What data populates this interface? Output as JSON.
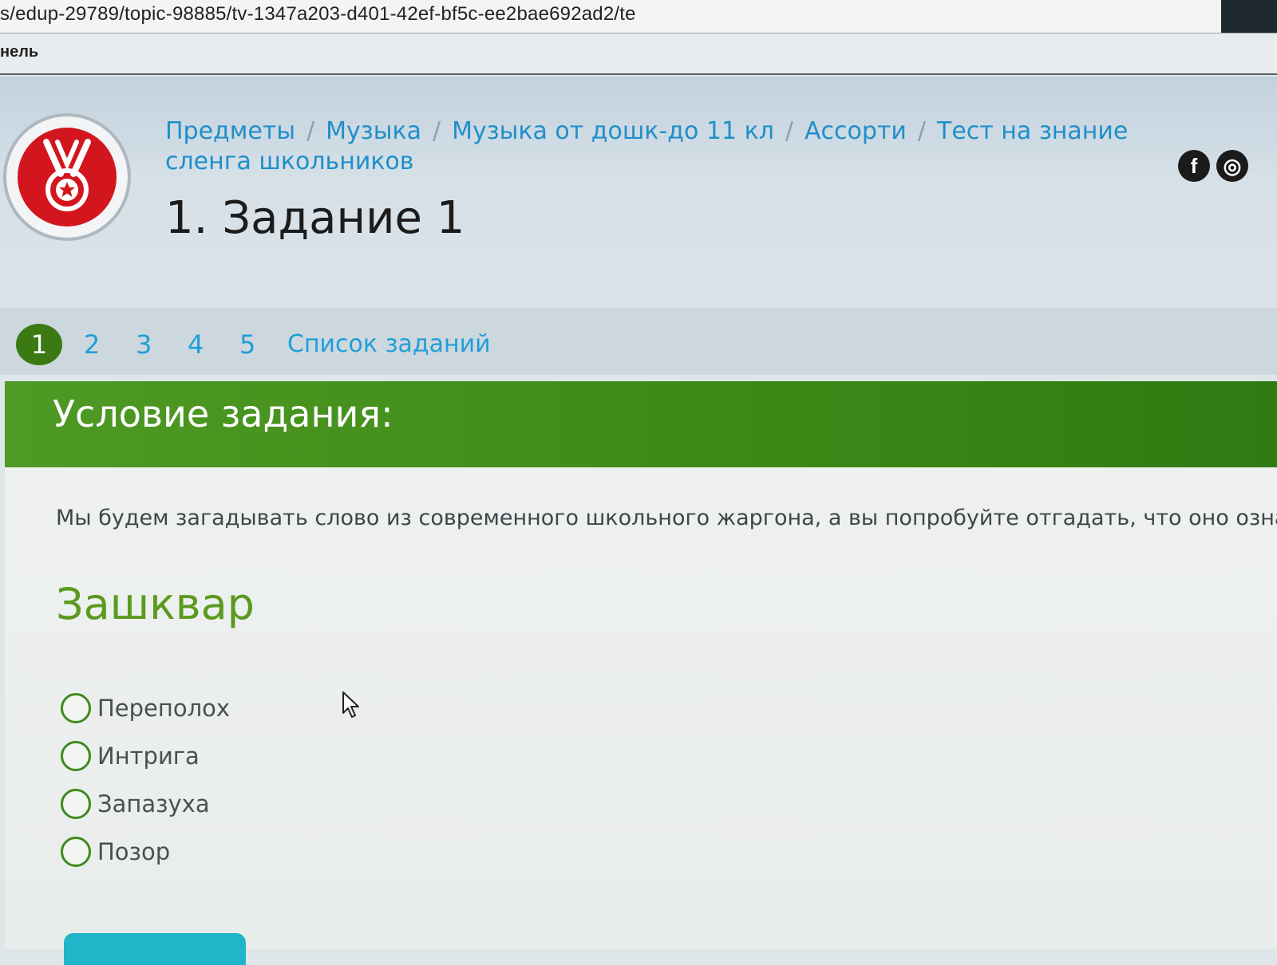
{
  "browser": {
    "address": "s/edup-29789/topic-98885/tv-1347a203-d401-42ef-bf5c-ee2bae692ad2/te",
    "bookmark": "нель"
  },
  "header": {
    "breadcrumb": [
      "Предметы",
      "Музыка",
      "Музыка от дошк-до 11 кл",
      "Ассорти",
      "Тест на знание сленга школьников"
    ],
    "separator": "/",
    "title": "1. Задание 1",
    "social": {
      "facebook": "f",
      "other": "◎"
    }
  },
  "task_nav": {
    "numbers": [
      "1",
      "2",
      "3",
      "4",
      "5"
    ],
    "active": "1",
    "list_link": "Список заданий"
  },
  "condition": {
    "heading": "Условие задания:",
    "instruction": "Мы будем загадывать слово из современного школьного жаргона, а вы попробуйте отгадать, что оно означа",
    "word": "Зашквар",
    "options": [
      "Переполох",
      "Интрига",
      "Запазуха",
      "Позор"
    ]
  },
  "colors": {
    "accent_green": "#3e8a17",
    "link_blue": "#1f8fc9",
    "logo_red": "#d3161d"
  }
}
